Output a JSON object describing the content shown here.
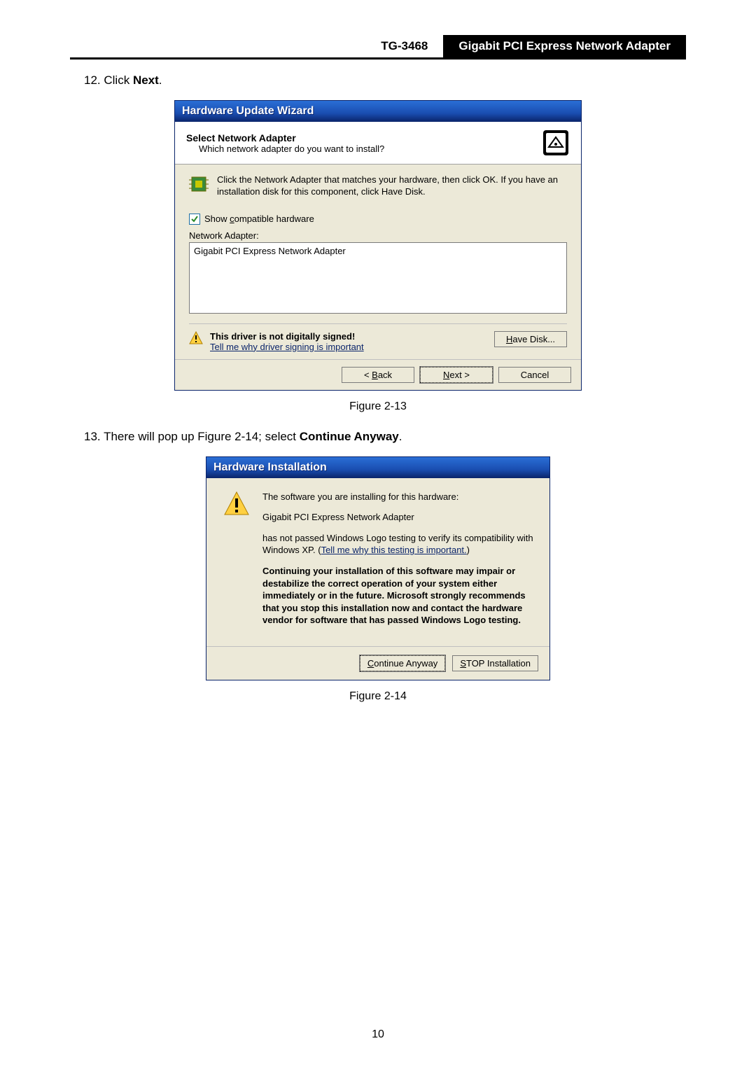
{
  "header": {
    "model": "TG-3468",
    "title": "Gigabit PCI Express Network Adapter"
  },
  "step12": {
    "number": "12.",
    "text": "Click ",
    "bold": "Next",
    "suffix": "."
  },
  "dialog1": {
    "title": "Hardware Update Wizard",
    "heading": "Select Network Adapter",
    "subheading": "Which network adapter do you want to install?",
    "info": "Click the Network Adapter that matches your hardware, then click OK. If you have an installation disk for this component, click Have Disk.",
    "checkbox_label": "Show compatible hardware",
    "list_label": "Network Adapter:",
    "list_item": "Gigabit PCI Express Network Adapter",
    "warning_title": "This driver is not digitally signed!",
    "warning_link": "Tell me why driver signing is important",
    "have_disk": "Have Disk...",
    "back": "< Back",
    "next": "Next >",
    "cancel": "Cancel"
  },
  "figure1": "Figure 2-13",
  "step13": {
    "number": "13.",
    "prefix": "There will pop up Figure 2-14; select ",
    "bold": "Continue Anyway",
    "suffix": "."
  },
  "dialog2": {
    "title": "Hardware Installation",
    "line1": "The software you are installing for this hardware:",
    "line2": "Gigabit PCI Express Network Adapter",
    "line3a": "has not passed Windows Logo testing to verify its compatibility with Windows XP. (",
    "line3_link": "Tell me why this testing is important.",
    "line3b": ")",
    "warning": "Continuing your installation of this software may impair or destabilize the correct operation of your system either immediately or in the future. Microsoft strongly recommends that you stop this installation now and contact the hardware vendor for software that has passed Windows Logo testing.",
    "continue": "Continue Anyway",
    "stop": "STOP Installation"
  },
  "figure2": "Figure 2-14",
  "page_number": "10"
}
